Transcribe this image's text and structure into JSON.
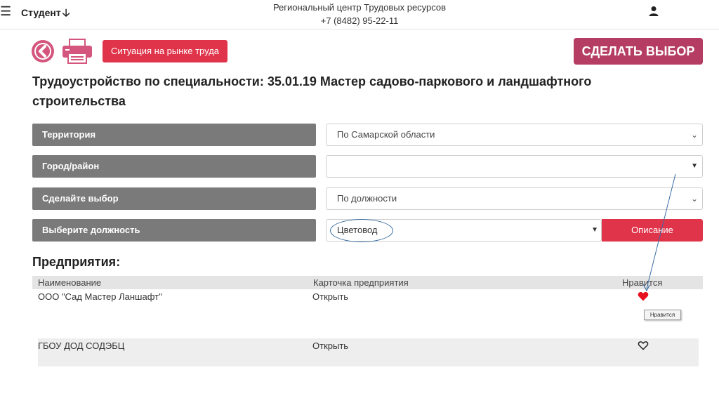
{
  "header": {
    "menu_icon": "hamburger-icon",
    "role_label": "Студент",
    "role_arrow": "🡣",
    "center_title": "Региональный центр Трудовых ресурсов",
    "center_phone": "+7 (8482) 95-22-11",
    "user_icon": "user-icon"
  },
  "actions": {
    "back_icon": "chevron-left-icon",
    "print_icon": "printer-icon",
    "market_label": "Ситуация на рынке труда",
    "choose_label": "СДЕЛАТЬ ВЫБОР"
  },
  "page_title": "Трудоустройство по специальности: 35.01.19 Мастер садово-паркового и ландшафтного строительства",
  "filters": [
    {
      "label": "Территория",
      "value": "По Самарской области"
    },
    {
      "label": "Город/район",
      "value": ""
    },
    {
      "label": "Сделайте выбор",
      "value": "По должности"
    },
    {
      "label": "Выберите должность",
      "value": "Цветовод"
    }
  ],
  "description_button": "Описание",
  "enterprises": {
    "title": "Предприятия:",
    "columns": [
      "Наименование",
      "Карточка предприятия",
      "Нравится"
    ],
    "rows": [
      {
        "name": "ООО \"Сад Мастер Ланшафт\"",
        "card": "Открыть",
        "liked": true
      },
      {
        "name": "ГБОУ ДОД СОДЭБЦ",
        "card": "Открыть",
        "liked": false
      }
    ],
    "tooltip": "Нравится"
  },
  "colors": {
    "accent_red": "#e0344b",
    "choose_button": "#b53d63",
    "back_button": "#d4567e",
    "filter_label_bg": "#7a7a7a",
    "heart_liked": "#e8101e",
    "annotation": "#3b6ea0"
  }
}
